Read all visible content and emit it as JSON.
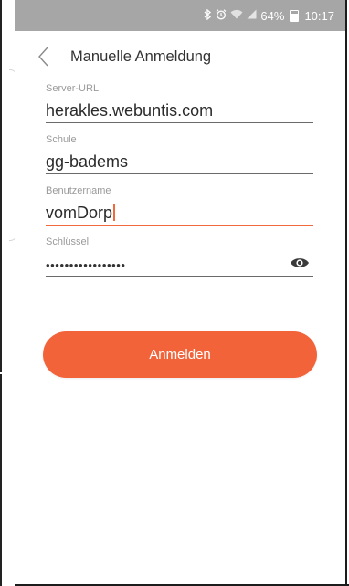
{
  "status_bar": {
    "icons": [
      "bluetooth-icon",
      "alarm-icon",
      "wifi-icon",
      "signal-icon"
    ],
    "battery_percent": "64%",
    "time": "10:17"
  },
  "header": {
    "title": "Manuelle Anmeldung",
    "back_icon": "chevron-left-icon"
  },
  "form": {
    "server_url": {
      "label": "Server-URL",
      "value": "herakles.webuntis.com"
    },
    "school": {
      "label": "Schule",
      "value": "gg-badems"
    },
    "username": {
      "label": "Benutzername",
      "value": "vomDorp"
    },
    "key": {
      "label": "Schlüssel",
      "value": "•••••••••••••••••",
      "toggle_icon": "eye-icon"
    }
  },
  "login_button": {
    "label": "Anmelden"
  },
  "colors": {
    "accent": "#f2633a",
    "status_bar": "#a6a6a6",
    "text": "#2a2a2a",
    "label": "#9a9a9a"
  }
}
